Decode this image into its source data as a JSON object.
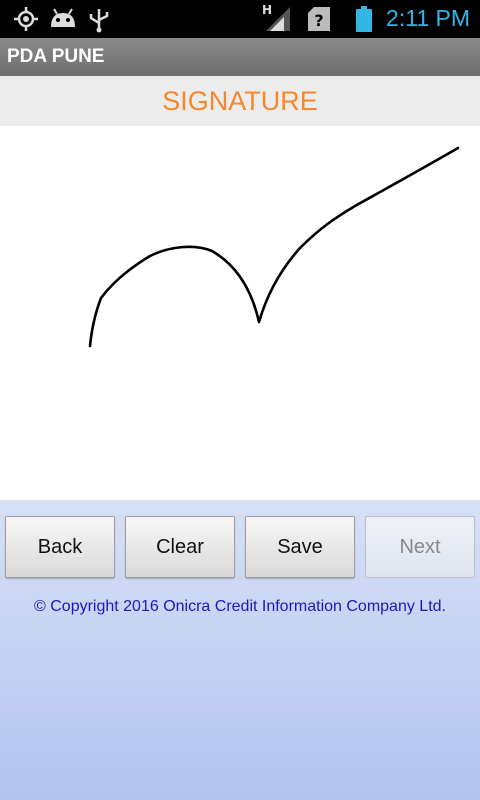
{
  "status_bar": {
    "time": "2:11 PM",
    "network_indicator": "H",
    "icons": [
      "gps-icon",
      "android-debug-icon",
      "usb-icon",
      "signal-icon",
      "sim-alert-icon",
      "battery-icon"
    ],
    "time_color": "#33b5e5"
  },
  "app": {
    "title": "PDA PUNE"
  },
  "header": {
    "title": "SIGNATURE",
    "color": "#f5882a"
  },
  "buttons": {
    "back": "Back",
    "clear": "Clear",
    "save": "Save",
    "next": "Next"
  },
  "footer": {
    "copyright": "© Copyright 2016 Onicra Credit Information Company Ltd."
  }
}
